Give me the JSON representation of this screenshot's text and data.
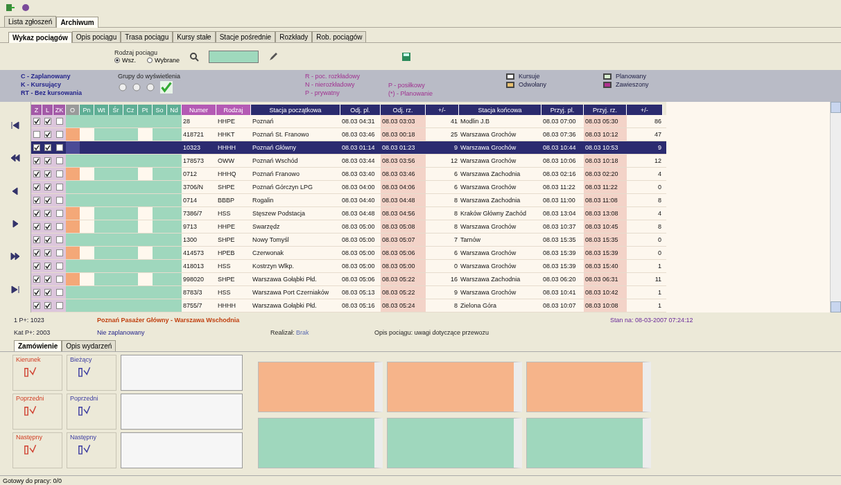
{
  "main_tabs": [
    {
      "label": "Lista zgłoszeń",
      "selected": false
    },
    {
      "label": "Archiwum",
      "selected": true
    }
  ],
  "sub_tabs": [
    {
      "label": "Wykaz pociągów",
      "selected": true
    },
    {
      "label": "Opis pociągu",
      "selected": false
    },
    {
      "label": "Trasa pociągu",
      "selected": false
    },
    {
      "label": "Kursy stałe",
      "selected": false
    },
    {
      "label": "Stacje pośrednie",
      "selected": false
    },
    {
      "label": "Rozkłady",
      "selected": false
    },
    {
      "label": "Rob. pociągów",
      "selected": false
    }
  ],
  "filter": {
    "label": "Rodzaj pociągu",
    "options": [
      {
        "label": "Wsz.",
        "selected": true
      },
      {
        "label": "Wybrane",
        "selected": false
      }
    ]
  },
  "legend_status": [
    {
      "label": "C - Zaplanowany"
    },
    {
      "label": "K - Kursujący"
    },
    {
      "label": "RT - Bez kursowania"
    }
  ],
  "groups_label": "Grupy do wyświetlenia",
  "legend_types": [
    {
      "label": "R - poc. rozkładowy"
    },
    {
      "label": "N - nierozkładowy"
    },
    {
      "label": "P - prywatny"
    },
    {
      "label": "P - posiłkowy"
    },
    {
      "label": "(*) - Planowanie"
    }
  ],
  "legend_colors": [
    {
      "label": "Kursuje",
      "color": "#ffffff"
    },
    {
      "label": "Odwołany",
      "color": "#e8c070"
    },
    {
      "label": "Planowany",
      "color": "#d8f0d0"
    },
    {
      "label": "Zawieszony",
      "color": "#b03090"
    }
  ],
  "table": {
    "columns": [
      {
        "label": "Z",
        "kind": "check"
      },
      {
        "label": "L",
        "kind": "check"
      },
      {
        "label": "ZK",
        "kind": "check"
      },
      {
        "label": "O",
        "kind": "mark"
      },
      {
        "label": "Pn",
        "kind": "day"
      },
      {
        "label": "Wt",
        "kind": "day"
      },
      {
        "label": "Śr",
        "kind": "day"
      },
      {
        "label": "Cz",
        "kind": "day"
      },
      {
        "label": "Pt",
        "kind": "day"
      },
      {
        "label": "So",
        "kind": "day"
      },
      {
        "label": "Nd",
        "kind": "day"
      },
      {
        "label": "Numer",
        "kind": "id"
      },
      {
        "label": "Rodzaj",
        "kind": "id"
      },
      {
        "label": "Stacja początkowa",
        "kind": "text"
      },
      {
        "label": "Odj. pl.",
        "kind": "text"
      },
      {
        "label": "Odj. rz.",
        "kind": "real"
      },
      {
        "label": "+/-",
        "kind": "num"
      },
      {
        "label": "Stacja końcowa",
        "kind": "text"
      },
      {
        "label": "Przyj. pl.",
        "kind": "text"
      },
      {
        "label": "Przyj. rz.",
        "kind": "real"
      },
      {
        "label": "+/-",
        "kind": "num"
      }
    ],
    "rows": [
      {
        "z": true,
        "l": true,
        "zk": false,
        "marked": false,
        "selected": false,
        "cells": [
          "28",
          "HHPE",
          "Poznań",
          "08.03 04:31",
          "08.03 03:03",
          "41",
          "Modlin J.B",
          "08.03 07:00",
          "08.03 05:30",
          "86"
        ]
      },
      {
        "z": false,
        "l": true,
        "zk": false,
        "marked": true,
        "selected": false,
        "cells": [
          "418721",
          "HHKT",
          "Poznań St. Franowo",
          "08.03 03:46",
          "08.03 00:18",
          "25",
          "Warszawa Grochów",
          "08.03 07:36",
          "08.03 10:12",
          "47"
        ]
      },
      {
        "z": true,
        "l": true,
        "zk": false,
        "marked": false,
        "selected": true,
        "cells": [
          "10323",
          "HHHH",
          "Poznań Główny",
          "08.03 01:14",
          "08.03 01:23",
          "9",
          "Warszawa Grochów",
          "08.03 10:44",
          "08.03 10:53",
          "9"
        ]
      },
      {
        "z": true,
        "l": true,
        "zk": false,
        "marked": false,
        "selected": false,
        "cells": [
          "178573",
          "OWW",
          "Poznań Wschód",
          "08.03 03:44",
          "08.03 03:56",
          "12",
          "Warszawa Grochów",
          "08.03 10:06",
          "08.03 10:18",
          "12"
        ]
      },
      {
        "z": true,
        "l": true,
        "zk": false,
        "marked": true,
        "selected": false,
        "cells": [
          "0712",
          "HHHQ",
          "Poznań Franowo",
          "08.03 03:40",
          "08.03 03:46",
          "6",
          "Warszawa Zachodnia",
          "08.03 02:16",
          "08.03 02:20",
          "4"
        ]
      },
      {
        "z": true,
        "l": true,
        "zk": false,
        "marked": false,
        "selected": false,
        "cells": [
          "3706/N",
          "SHPE",
          "Poznań Górczyn LPG",
          "08.03 04:00",
          "08.03 04:06",
          "6",
          "Warszawa Grochów",
          "08.03 11:22",
          "08.03 11:22",
          "0"
        ]
      },
      {
        "z": true,
        "l": true,
        "zk": false,
        "marked": false,
        "selected": false,
        "cells": [
          "0714",
          "BBBP",
          "Rogalin",
          "08.03 04:40",
          "08.03 04:48",
          "8",
          "Warszawa Zachodnia",
          "08.03 11:00",
          "08.03 11:08",
          "8"
        ]
      },
      {
        "z": true,
        "l": true,
        "zk": false,
        "marked": true,
        "selected": false,
        "cells": [
          "7386/7",
          "HSS",
          "Stęszew Podstacja",
          "08.03 04:48",
          "08.03 04:56",
          "8",
          "Kraków Główny Zachód",
          "08.03 13:04",
          "08.03 13:08",
          "4"
        ]
      },
      {
        "z": true,
        "l": true,
        "zk": false,
        "marked": true,
        "selected": false,
        "cells": [
          "9713",
          "HHPE",
          "Swarzędz",
          "08.03 05:00",
          "08.03 05:08",
          "8",
          "Warszawa Grochów",
          "08.03 10:37",
          "08.03 10:45",
          "8"
        ]
      },
      {
        "z": true,
        "l": true,
        "zk": false,
        "marked": false,
        "selected": false,
        "cells": [
          "1300",
          "SHPE",
          "Nowy Tomyśl",
          "08.03 05:00",
          "08.03 05:07",
          "7",
          "Tarnów",
          "08.03 15:35",
          "08.03 15:35",
          "0"
        ]
      },
      {
        "z": true,
        "l": true,
        "zk": false,
        "marked": true,
        "selected": false,
        "cells": [
          "414573",
          "HPEB",
          "Czerwonak",
          "08.03 05:00",
          "08.03 05:06",
          "6",
          "Warszawa Grochów",
          "08.03 15:39",
          "08.03 15:39",
          "0"
        ]
      },
      {
        "z": true,
        "l": true,
        "zk": false,
        "marked": false,
        "selected": false,
        "cells": [
          "418013",
          "HSS",
          "Kostrzyn Wlkp.",
          "08.03 05:00",
          "08.03 05:00",
          "0",
          "Warszawa Grochów",
          "08.03 15:39",
          "08.03 15:40",
          "1"
        ]
      },
      {
        "z": true,
        "l": true,
        "zk": false,
        "marked": true,
        "selected": false,
        "cells": [
          "998020",
          "SHPE",
          "Warszawa Gołąbki Płd.",
          "08.03 05:06",
          "08.03 05:22",
          "16",
          "Warszawa Zachodnia",
          "08.03 06:20",
          "08.03 06:31",
          "11"
        ]
      },
      {
        "z": true,
        "l": true,
        "zk": false,
        "marked": false,
        "selected": false,
        "cells": [
          "8783/3",
          "HSS",
          "Warszawa Port Czerniaków",
          "08.03 05:13",
          "08.03 05:22",
          "9",
          "Warszawa Grochów",
          "08.03 10:41",
          "08.03 10:42",
          "1"
        ]
      },
      {
        "z": true,
        "l": true,
        "zk": false,
        "marked": false,
        "selected": false,
        "cells": [
          "8755/7",
          "HHHH",
          "Warszawa Gołąbki Płd.",
          "08.03 05:16",
          "08.03 05:24",
          "8",
          "Zielona Góra",
          "08.03 10:07",
          "08.03 10:08",
          "1"
        ]
      }
    ]
  },
  "info": {
    "left": [
      "1 P+: 1023",
      "Kat P+: 2003"
    ],
    "route": "Poznań Pasażer Główny - Warszawa Wschodnia",
    "plan": "Nie zaplanowany",
    "realised_label": "Realizał:",
    "realised": "Brak",
    "description": "Opis pociągu: uwagi dotyczące przewozu",
    "state": "Stan na: 08-03-2007 07:24:12"
  },
  "bottom_tabs": [
    {
      "label": "Zamówienie",
      "selected": true
    },
    {
      "label": "Opis wydarzeń",
      "selected": false
    }
  ],
  "bottom_groups": [
    {
      "left": "Kierunek",
      "right": "Bieżący"
    },
    {
      "left": "Poprzedni",
      "right": "Poprzedni"
    },
    {
      "left": "Następny",
      "right": "Następny"
    }
  ],
  "status_bar": "Gotowy do pracy: 0/0"
}
